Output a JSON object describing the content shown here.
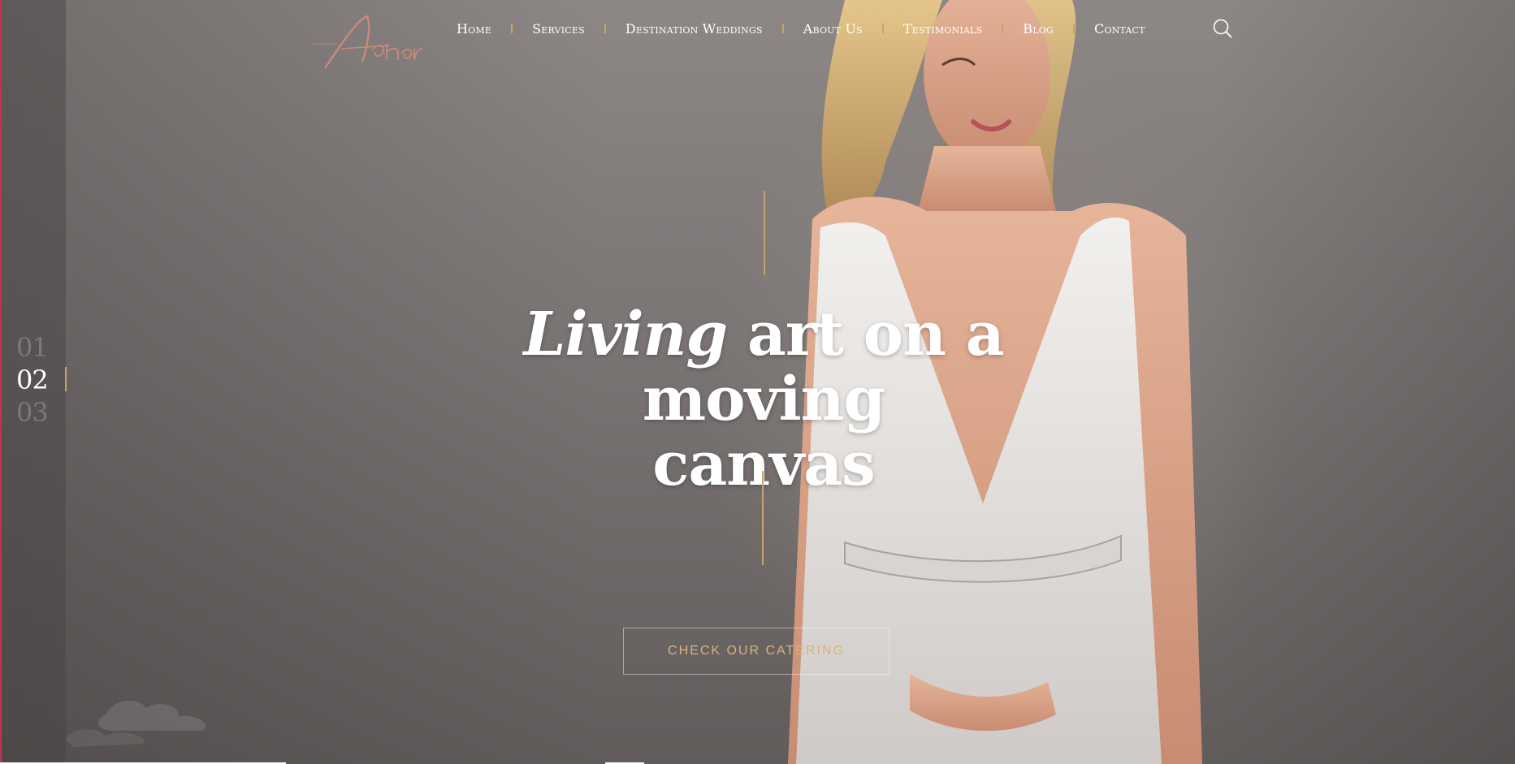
{
  "brand": {
    "logo_icon": "asher-script-logo",
    "accent_color": "#c9a26b",
    "edge_color": "#c2334f"
  },
  "nav": {
    "items": [
      {
        "label": "Home"
      },
      {
        "label": "Services"
      },
      {
        "label": "Destination Weddings"
      },
      {
        "label": "About Us"
      },
      {
        "label": "Testimonials"
      },
      {
        "label": "Blog"
      },
      {
        "label": "Contact"
      }
    ],
    "search_icon": "search-icon"
  },
  "slider": {
    "numbers": [
      "01",
      "02",
      "03"
    ],
    "active_index": 1
  },
  "hero": {
    "headline_italic": "Living",
    "headline_rest": " art on a moving",
    "headline_line2": "canvas",
    "cta_label": "CHECK OUR CATERING"
  }
}
